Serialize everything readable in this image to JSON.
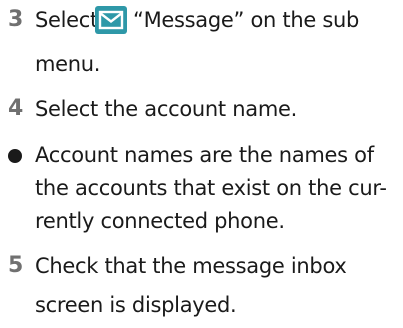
{
  "steps": [
    {
      "number": "3",
      "text_before_icon": "Select",
      "icon": "message-envelope-icon",
      "icon_color": "#2e98a8",
      "text_after_icon": "“Message” on the sub",
      "continuation": "menu."
    },
    {
      "number": "4",
      "text": "Select the account name."
    },
    {
      "number": "5",
      "line1": "Check that the message inbox",
      "line2": "screen is displayed."
    }
  ],
  "note": {
    "line1": "Account names are the names of",
    "line2": "the accounts that exist on the cur-",
    "line3": "rently connected phone."
  }
}
